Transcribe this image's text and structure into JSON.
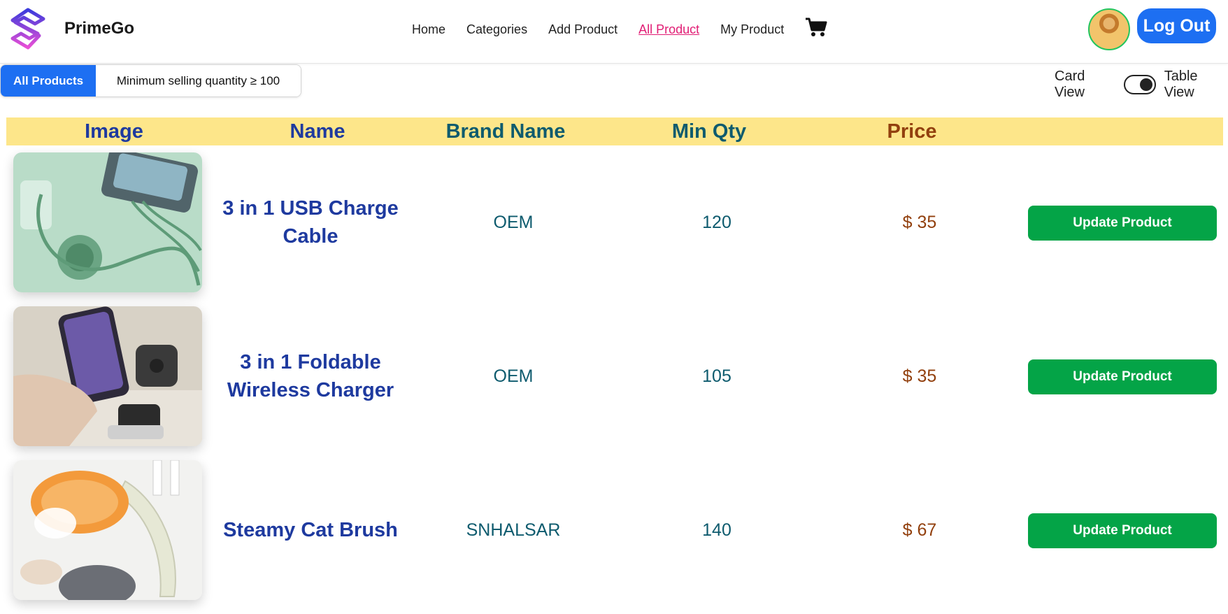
{
  "navbar": {
    "brand_name": "PrimeGo",
    "links": [
      "Home",
      "Categories",
      "Add Product",
      "All Product",
      "My Product"
    ],
    "active_link": "All Product",
    "logout_label": "Log Out"
  },
  "filters": {
    "all_products_label": "All Products",
    "min_qty_label": "Minimum selling quantity ≥ 100"
  },
  "view_toggle": {
    "card_label": "Card View",
    "table_label": "Table View",
    "state": "table"
  },
  "table": {
    "headers": [
      "Image",
      "Name",
      "Brand Name",
      "Min Qty",
      "Price"
    ],
    "rows": [
      {
        "name": "3 in 1 USB Charge Cable",
        "brand": "OEM",
        "min_qty": "120",
        "price": "$ 35",
        "action": "Update Product"
      },
      {
        "name": "3 in 1 Foldable Wireless Charger",
        "brand": "OEM",
        "min_qty": "105",
        "price": "$ 35",
        "action": "Update Product"
      },
      {
        "name": "Steamy Cat Brush",
        "brand": "SNHALSAR",
        "min_qty": "140",
        "price": "$ 67",
        "action": "Update Product"
      }
    ]
  },
  "colors": {
    "primary_blue": "#1d6ff2",
    "header_yellow": "#fde68a",
    "active_link_pink": "#e11d74",
    "action_green": "#04a447",
    "name_blue": "#1e3a9f",
    "teal": "#0e5b6e",
    "price_brown": "#92400e"
  }
}
